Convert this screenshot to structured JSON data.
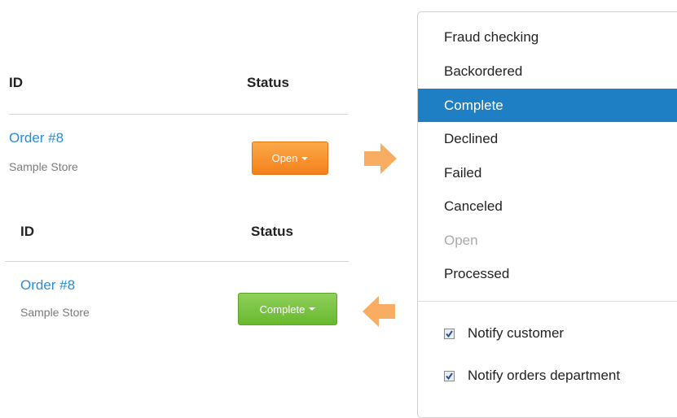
{
  "table_top": {
    "col_id": "ID",
    "col_status": "Status",
    "order_link": "Order #8",
    "store_name": "Sample Store",
    "status_button": "Open"
  },
  "table_bottom": {
    "col_id": "ID",
    "col_status": "Status",
    "order_link": "Order #8",
    "store_name": "Sample Store",
    "status_button": "Complete"
  },
  "status_menu": {
    "items": [
      {
        "label": "Fraud checking",
        "state": "normal"
      },
      {
        "label": "Backordered",
        "state": "normal"
      },
      {
        "label": "Complete",
        "state": "selected"
      },
      {
        "label": "Declined",
        "state": "normal"
      },
      {
        "label": "Failed",
        "state": "normal"
      },
      {
        "label": "Canceled",
        "state": "normal"
      },
      {
        "label": "Open",
        "state": "disabled"
      },
      {
        "label": "Processed",
        "state": "normal"
      }
    ],
    "notify_customer": {
      "label": "Notify customer",
      "checked": true
    },
    "notify_orders": {
      "label": "Notify orders department",
      "checked": true
    }
  },
  "icons": {
    "arrow_right": "arrow-right-icon",
    "arrow_left": "arrow-left-icon",
    "caret": "chevron-down-icon",
    "check": "checkbox-checked-icon"
  },
  "colors": {
    "link": "#2a8bd8",
    "open_button": "#f4801a",
    "complete_button": "#68b82e",
    "menu_selected": "#1f7fc4",
    "arrow": "#f8ad62"
  }
}
